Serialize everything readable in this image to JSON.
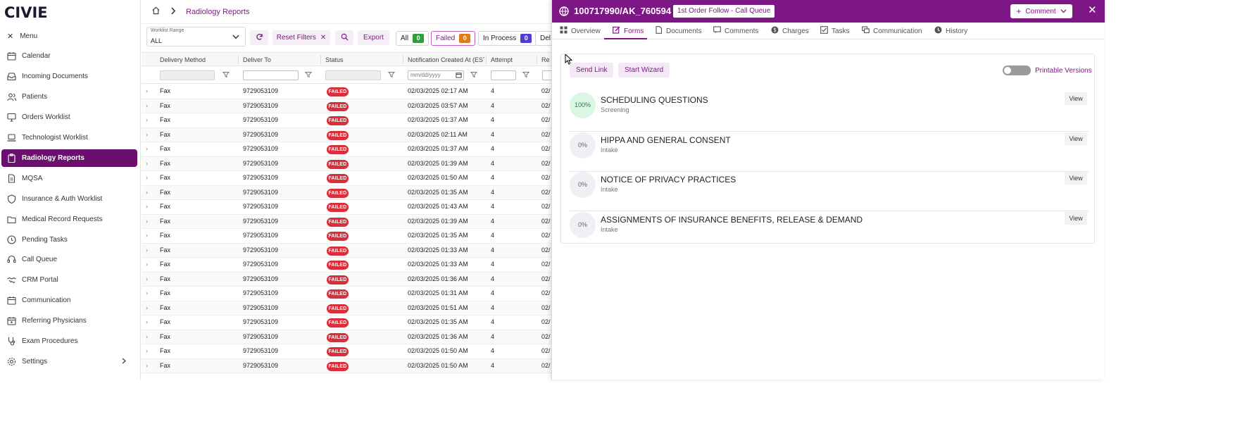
{
  "app": {
    "logo": "CIVIE"
  },
  "sidebar": {
    "menu_label": "Menu",
    "items": [
      {
        "label": "Calendar",
        "icon": "calendar-icon"
      },
      {
        "label": "Incoming Documents",
        "icon": "inbox-icon"
      },
      {
        "label": "Patients",
        "icon": "users-icon"
      },
      {
        "label": "Orders Worklist",
        "icon": "monitor-icon"
      },
      {
        "label": "Technologist Worklist",
        "icon": "laptop-icon"
      },
      {
        "label": "Radiology Reports",
        "icon": "clipboard-icon",
        "active": true
      },
      {
        "label": "MQSA",
        "icon": "document-icon"
      },
      {
        "label": "Insurance & Auth Worklist",
        "icon": "shield-icon"
      },
      {
        "label": "Medical Record Requests",
        "icon": "folder-icon"
      },
      {
        "label": "Pending Tasks",
        "icon": "clock-icon"
      },
      {
        "label": "Call Queue",
        "icon": "headset-icon"
      },
      {
        "label": "CRM Portal",
        "icon": "handshake-icon"
      },
      {
        "label": "Communication",
        "icon": "calendar-chat-icon"
      },
      {
        "label": "Referring Physicians",
        "icon": "calendar-user-icon"
      },
      {
        "label": "Exam Procedures",
        "icon": "stethoscope-icon"
      },
      {
        "label": "Settings",
        "icon": "gear-icon"
      }
    ]
  },
  "main": {
    "title": "Radiology Reports",
    "worklist_range": {
      "label": "Worklist Range",
      "value": "ALL"
    },
    "reset_filters": "Reset Filters",
    "export": "Export",
    "status_pills": [
      {
        "label": "All",
        "count": "0",
        "color": "#2e9e3f"
      },
      {
        "label": "Failed",
        "count": "0",
        "color": "#e07b17",
        "selected": true
      },
      {
        "label": "In Process",
        "count": "0",
        "color": "#4d3fd1"
      },
      {
        "label": "Del"
      }
    ],
    "columns": [
      "Delivery Method",
      "Deliver To",
      "Status",
      "Notification Created At (EST)",
      "Attempt",
      "Re"
    ],
    "date_placeholder": "mm/dd/yyyy",
    "row_common": {
      "method": "Fax",
      "to": "9729053109",
      "status": "FAILED",
      "attempt": "4",
      "trunc": "02/"
    },
    "row_dates": [
      "02/03/2025 02:17 AM",
      "02/03/2025 03:57 AM",
      "02/03/2025 01:37 AM",
      "02/03/2025 02:11 AM",
      "02/03/2025 01:37 AM",
      "02/03/2025 01:39 AM",
      "02/03/2025 01:50 AM",
      "02/03/2025 01:35 AM",
      "02/03/2025 01:43 AM",
      "02/03/2025 01:39 AM",
      "02/03/2025 01:35 AM",
      "02/03/2025 01:33 AM",
      "02/03/2025 01:33 AM",
      "02/03/2025 01:36 AM",
      "02/03/2025 01:31 AM",
      "02/03/2025 01:51 AM",
      "02/03/2025 01:35 AM",
      "02/03/2025 01:36 AM",
      "02/03/2025 01:50 AM",
      "02/03/2025 01:50 AM"
    ]
  },
  "panel": {
    "id": "100717990/AK_760594",
    "tag": "1st Order Follow - Call Queue",
    "comment": "Comment",
    "tabs": [
      {
        "label": "Overview",
        "icon": "grid-icon"
      },
      {
        "label": "Forms",
        "icon": "pen-square-icon",
        "active": true
      },
      {
        "label": "Documents",
        "icon": "document-icon"
      },
      {
        "label": "Comments",
        "icon": "chat-icon"
      },
      {
        "label": "Charges",
        "icon": "dollar-icon"
      },
      {
        "label": "Tasks",
        "icon": "tasks-icon"
      },
      {
        "label": "Communication",
        "icon": "chat-bubbles-icon"
      },
      {
        "label": "History",
        "icon": "history-icon"
      }
    ],
    "send_link": "Send Link",
    "start_wizard": "Start Wizard",
    "printable_versions": "Printable Versions",
    "forms": [
      {
        "progress": "100%",
        "title": "SCHEDULING QUESTIONS",
        "subtitle": "Screening",
        "view": "View"
      },
      {
        "progress": "0%",
        "title": "HIPPA AND GENERAL CONSENT",
        "subtitle": "Intake",
        "view": "View"
      },
      {
        "progress": "0%",
        "title": "NOTICE OF PRIVACY PRACTICES",
        "subtitle": "Intake",
        "view": "View"
      },
      {
        "progress": "0%",
        "title": "ASSIGNMENTS OF INSURANCE BENEFITS, RELEASE & DEMAND",
        "subtitle": "Intake",
        "view": "View"
      }
    ]
  },
  "colors": {
    "brand": "#7d1785",
    "active_nav": "#6b0f6f",
    "failed": "#d92f3a"
  }
}
